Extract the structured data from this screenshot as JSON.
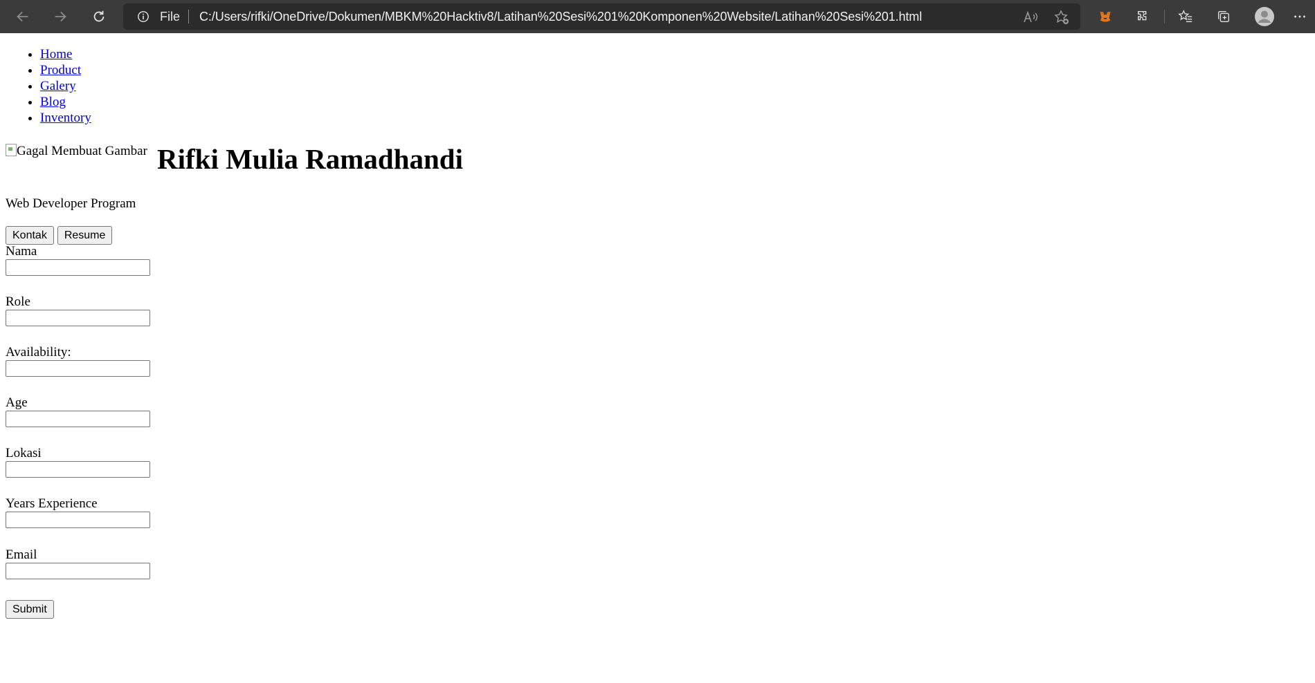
{
  "browser": {
    "scheme": "File",
    "url": "C:/Users/rifki/OneDrive/Dokumen/MBKM%20Hacktiv8/Latihan%20Sesi%201%20Komponen%20Website/Latihan%20Sesi%201.html",
    "icons": [
      "back-icon",
      "forward-icon",
      "refresh-icon",
      "info-icon",
      "read-aloud-icon",
      "add-favorite-icon",
      "metamask-icon",
      "extensions-icon",
      "favorites-icon",
      "collections-icon",
      "profile-icon",
      "more-icon"
    ]
  },
  "nav": {
    "items": [
      "Home",
      "Product",
      "Galery",
      "Blog",
      "Inventory"
    ]
  },
  "hero": {
    "image_alt": "Gagal Membuat Gambar",
    "name": "Rifki Mulia Ramadhandi",
    "subtitle": "Web Developer Program"
  },
  "buttons": {
    "kontak": "Kontak",
    "resume": "Resume"
  },
  "form": {
    "fields": [
      {
        "label": "Nama",
        "value": ""
      },
      {
        "label": "Role",
        "value": ""
      },
      {
        "label": "Availability:",
        "value": ""
      },
      {
        "label": "Age",
        "value": ""
      },
      {
        "label": "Lokasi",
        "value": ""
      },
      {
        "label": "Years Experience",
        "value": ""
      },
      {
        "label": "Email",
        "value": ""
      }
    ],
    "submit": "Submit"
  },
  "colors": {
    "chrome_bg": "#3b3b3b",
    "address_bar_bg": "#2b2b2b",
    "link": "#0000ee"
  }
}
